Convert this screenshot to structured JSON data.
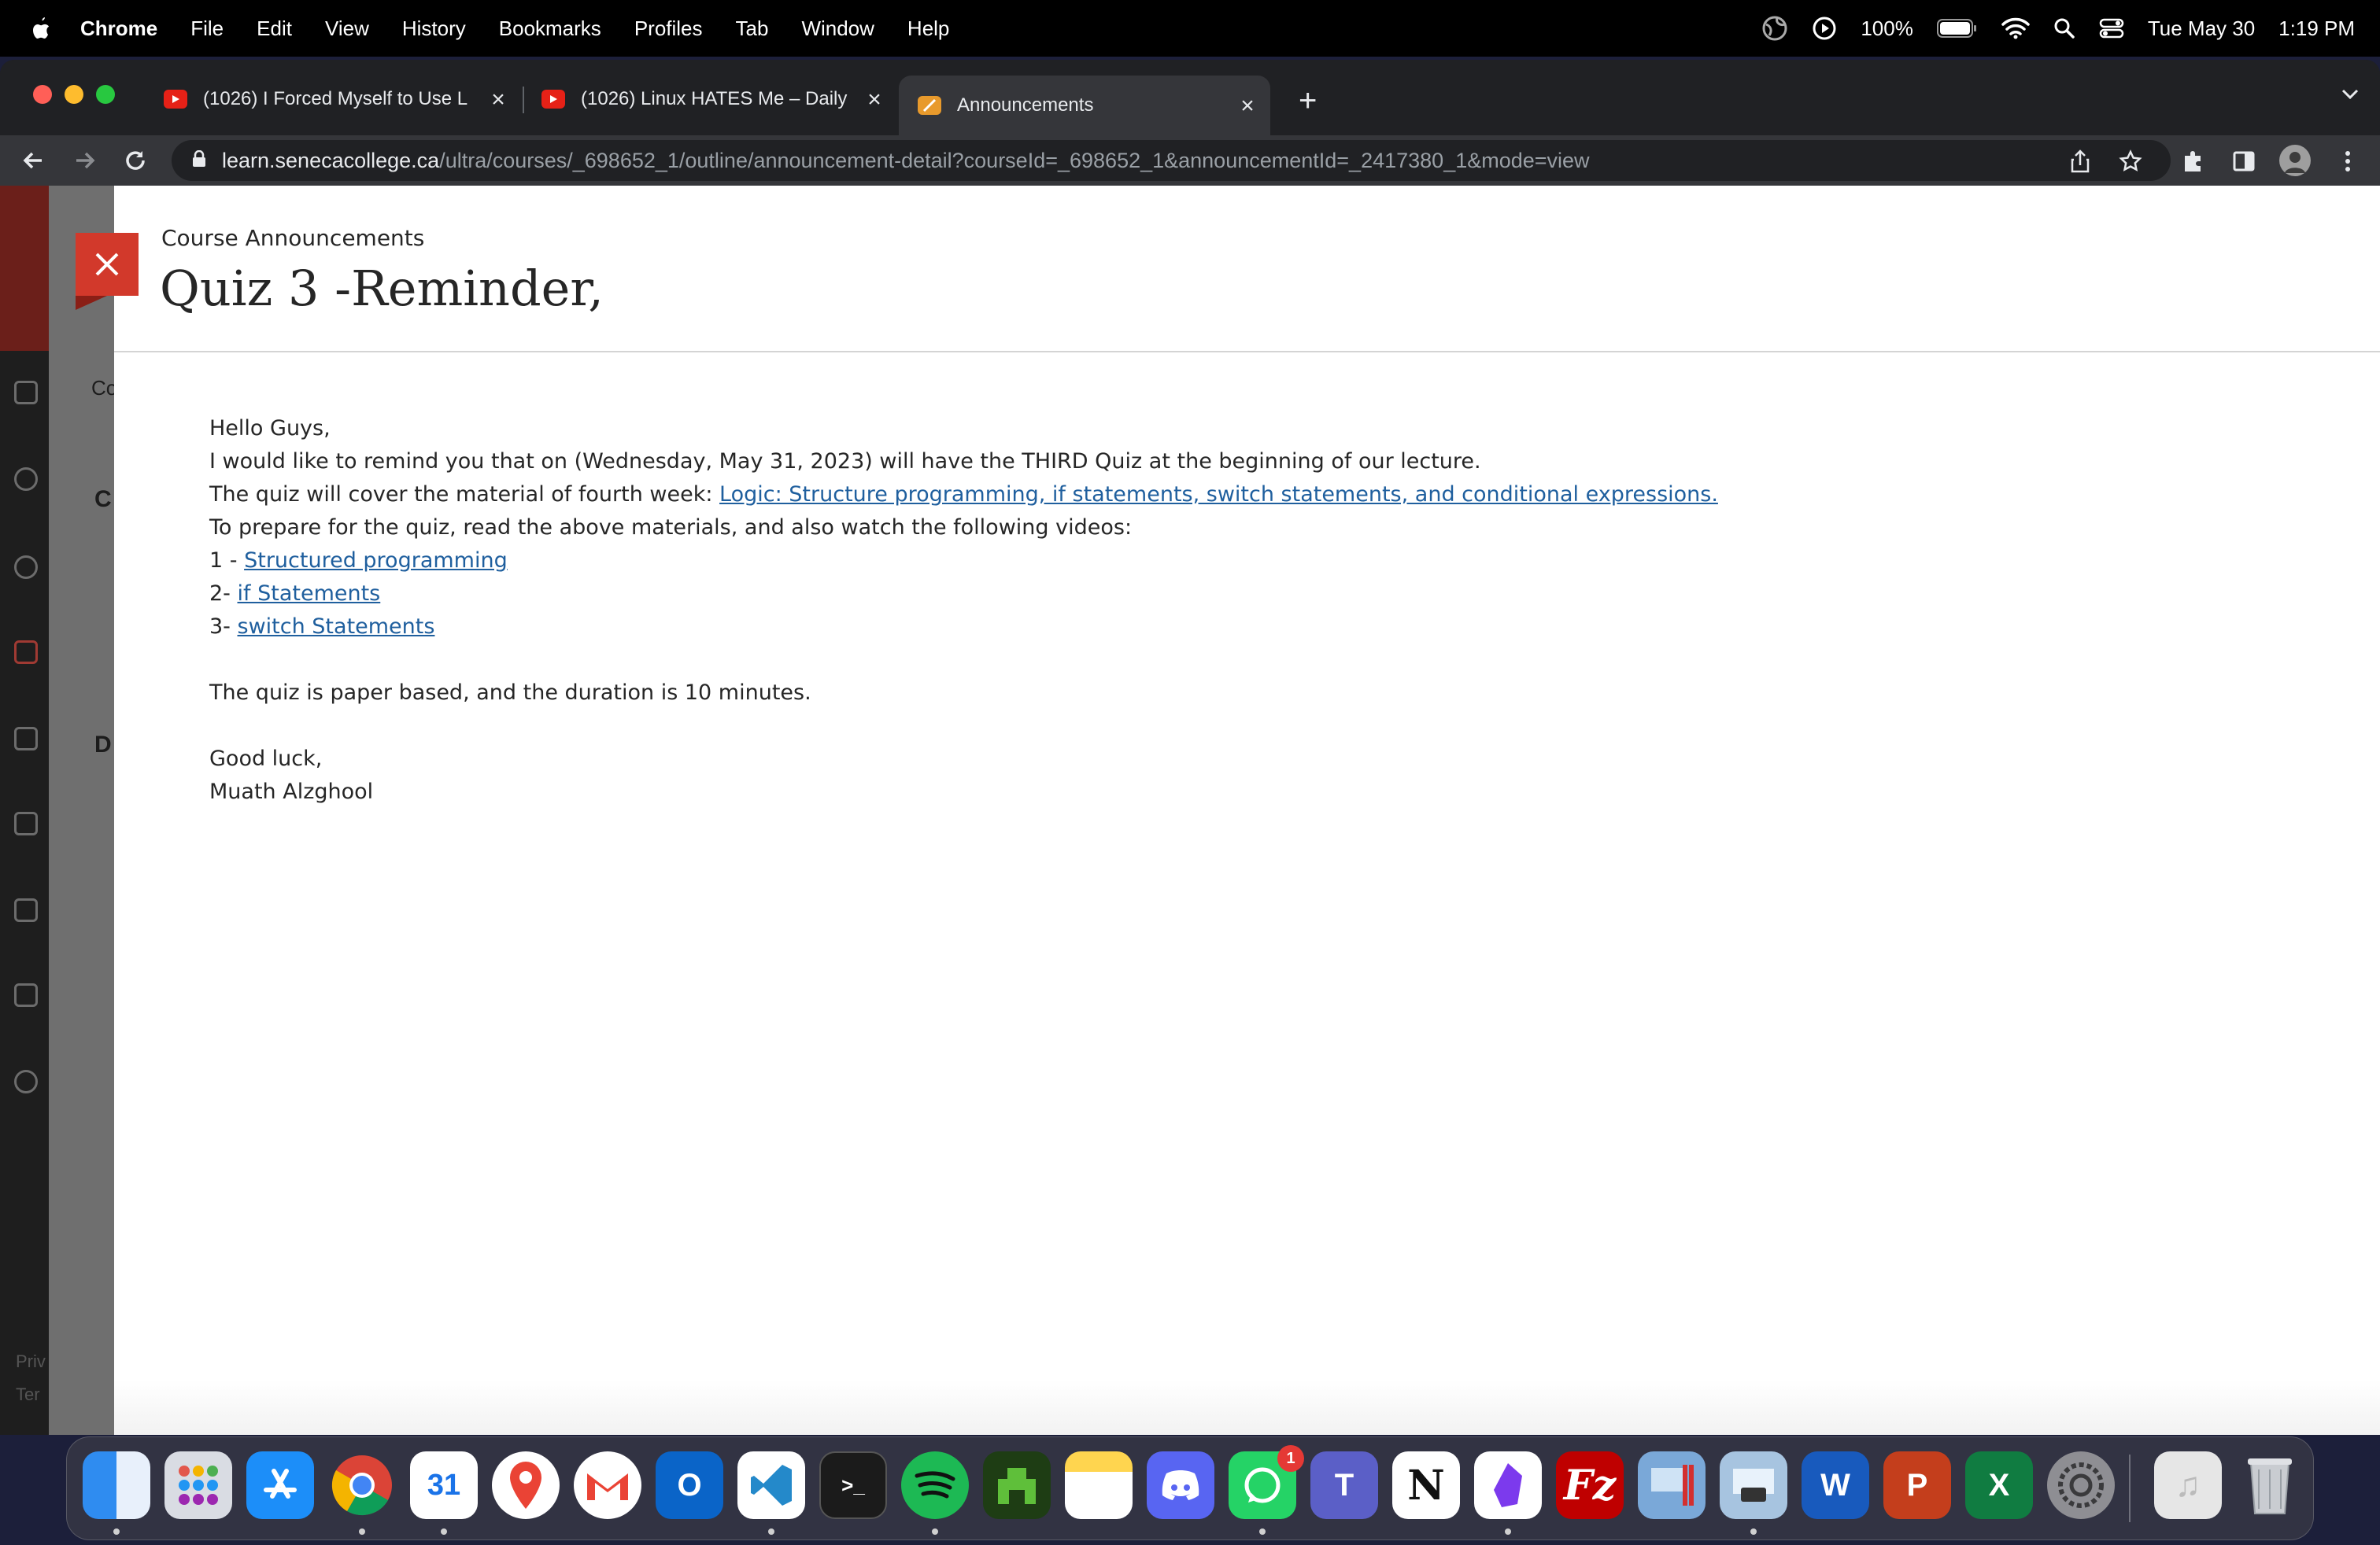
{
  "menubar": {
    "app": "Chrome",
    "items": [
      "File",
      "Edit",
      "View",
      "History",
      "Bookmarks",
      "Profiles",
      "Tab",
      "Window",
      "Help"
    ],
    "battery": "100%",
    "date": "Tue May 30",
    "time": "1:19 PM"
  },
  "tabs": [
    {
      "title": "(1026) I Forced Myself to Use L",
      "favicon": "youtube-icon"
    },
    {
      "title": "(1026) Linux HATES Me – Daily",
      "favicon": "youtube-icon"
    },
    {
      "title": "Announcements",
      "favicon": "blackboard-icon"
    }
  ],
  "address": {
    "host": "learn.senecacollege.ca",
    "path": "/ultra/courses/_698652_1/outline/announcement-detail?courseId=_698652_1&announcementId=_2417380_1&mode=view"
  },
  "panel": {
    "breadcrumb": "Course Announcements",
    "title": "Quiz 3 -Reminder,"
  },
  "announcement": {
    "greeting": "Hello Guys,",
    "line1": "I would like to remind you that on (Wednesday, May 31, 2023) will have the THIRD Quiz at the beginning of our lecture.",
    "line2_prefix": "The quiz will cover the material of fourth week: ",
    "line2_link": "Logic: Structure programming, if statements, switch statements, and conditional expressions.",
    "line3": "To prepare for the quiz, read the above materials, and also watch the following videos:",
    "videos": [
      {
        "prefix": "1 - ",
        "link": "Structured programming"
      },
      {
        "prefix": "2- ",
        "link": "if Statements"
      },
      {
        "prefix": "3- ",
        "link": "switch Statements"
      }
    ],
    "format": "The quiz is paper based, and the duration is 10 minutes.",
    "closing": "Good luck,",
    "signature": "Muath Alzghool"
  },
  "backdrop": {
    "fragments": [
      "Co",
      "C",
      "D"
    ],
    "footer": [
      "Priv",
      "Ter"
    ]
  },
  "dock": {
    "whatsapp_badge": "1",
    "apps": [
      "finder",
      "launchpad",
      "app-store",
      "chrome",
      "calendar",
      "maps",
      "gmail",
      "outlook",
      "vscode",
      "terminal",
      "spotify",
      "minecraft",
      "notes",
      "discord",
      "whatsapp",
      "teams",
      "notion",
      "obsidian",
      "filezilla",
      "parallels",
      "preview",
      "word",
      "powerpoint",
      "excel",
      "system-settings",
      "music",
      "trash"
    ],
    "calendar_day": "31"
  },
  "colors": {
    "close_button": "#d2392b",
    "link": "#1f5f9e"
  }
}
